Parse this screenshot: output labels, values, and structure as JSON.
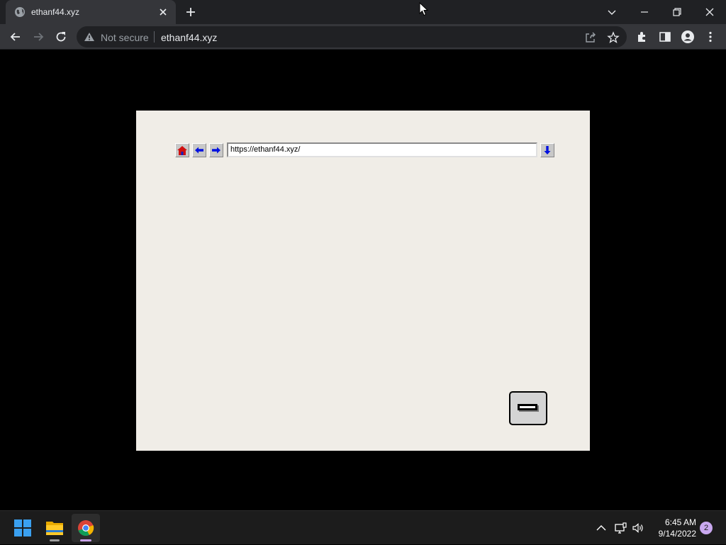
{
  "browser": {
    "tab": {
      "title": "ethanf44.xyz",
      "favicon": "globe-icon"
    },
    "omnibox": {
      "security_label": "Not secure",
      "url": "ethanf44.xyz"
    }
  },
  "app": {
    "address_value": "https://ethanf44.xyz/",
    "buttons": [
      "home-icon",
      "back-arrow-icon",
      "forward-arrow-icon",
      "go-down-arrow-icon",
      "minimize-icon"
    ]
  },
  "taskbar": {
    "time": "6:45 AM",
    "date": "9/14/2022",
    "notification_count": "2"
  },
  "colors": {
    "browser_frame": "#202124",
    "browser_toolbar": "#35363a",
    "app_background": "#f0ede7",
    "accent": "#c9a8ef"
  }
}
